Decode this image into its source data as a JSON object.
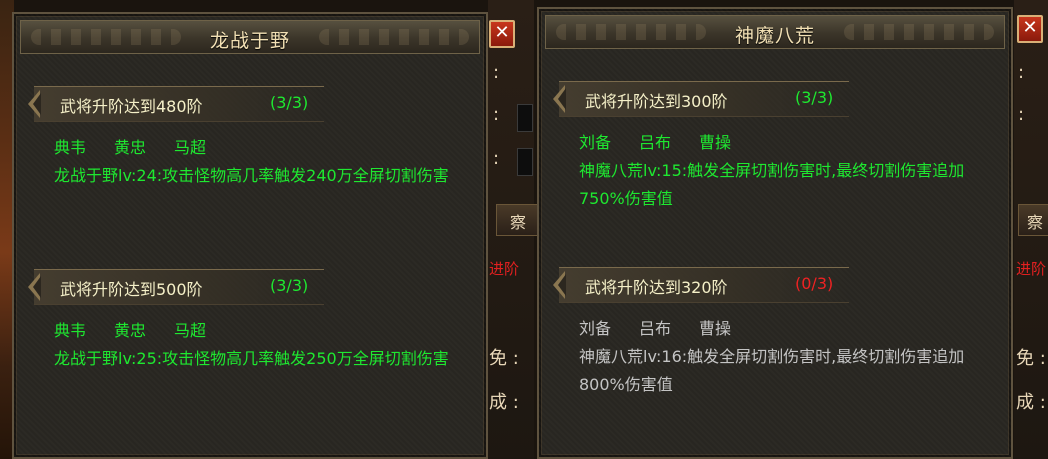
{
  "background": {
    "fragments_left_panel_right": [
      ":",
      ":",
      ":"
    ],
    "fragments_right_edge": [
      ":",
      ":",
      "免 :",
      "成 :"
    ],
    "red_fragment_mid": "进阶",
    "red_fragment_right": "进阶",
    "tab_glyph_mid": "察",
    "tab_glyph_right": "察",
    "bottom_mid_glyph": "免 :",
    "bottom_mid_glyph2": "成 :"
  },
  "panels": [
    {
      "title": "龙战于野",
      "close_label": "✕",
      "sections": [
        {
          "requirement": "武将升阶达到480阶",
          "progress": "(3/3)",
          "progress_color": "#1ee830",
          "heroes": [
            "典韦",
            "黄忠",
            "马超"
          ],
          "description": "龙战于野lv:24:攻击怪物高几率触发240万全屏切割伤害",
          "active": true
        },
        {
          "requirement": "武将升阶达到500阶",
          "progress": "(3/3)",
          "progress_color": "#1ee830",
          "heroes": [
            "典韦",
            "黄忠",
            "马超"
          ],
          "description": "龙战于野lv:25:攻击怪物高几率触发250万全屏切割伤害",
          "active": true
        }
      ]
    },
    {
      "title": "神魔八荒",
      "close_label": "✕",
      "sections": [
        {
          "requirement": "武将升阶达到300阶",
          "progress": "(3/3)",
          "progress_color": "#1ee830",
          "heroes": [
            "刘备",
            "吕布",
            "曹操"
          ],
          "description": "神魔八荒lv:15:触发全屏切割伤害时,最终切割伤害追加750%伤害值",
          "active": true
        },
        {
          "requirement": "武将升阶达到320阶",
          "progress": "(0/3)",
          "progress_color": "#ee2222",
          "heroes": [
            "刘备",
            "吕布",
            "曹操"
          ],
          "description": "神魔八荒lv:16:触发全屏切割伤害时,最终切割伤害追加800%伤害值",
          "active": false
        }
      ]
    }
  ],
  "colors": {
    "active_text": "#1ee830",
    "inactive_text": "#c4c4c4",
    "incomplete_progress": "#ee2222",
    "title_text": "#f2e0b4"
  }
}
